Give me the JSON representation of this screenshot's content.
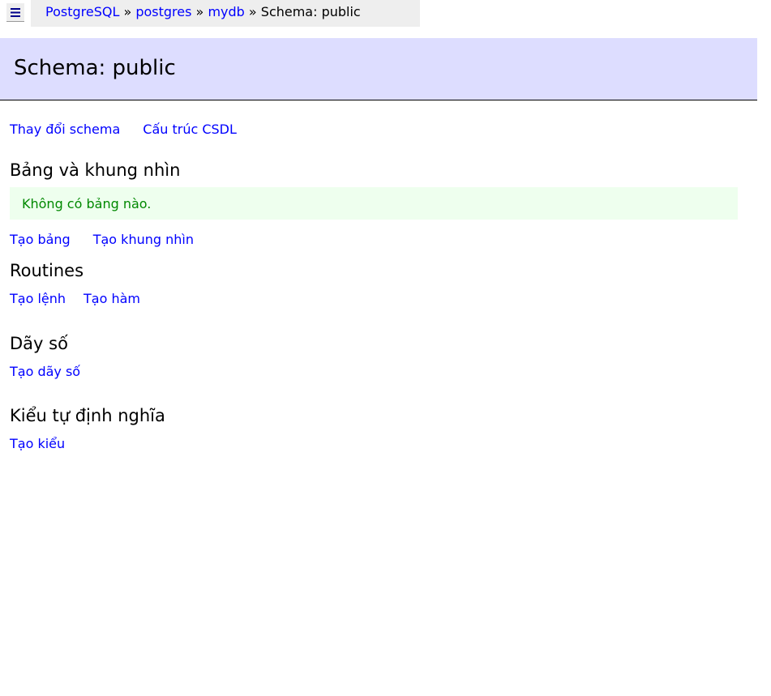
{
  "breadcrumb": {
    "items": [
      "PostgreSQL",
      "postgres",
      "mydb"
    ],
    "separator": " » ",
    "current": "Schema: public"
  },
  "header": {
    "title": "Schema: public"
  },
  "top_links": [
    "Thay đổi schema",
    "Cấu trúc CSDL"
  ],
  "tables": {
    "heading": "Bảng và khung nhìn",
    "message": "Không có bảng nào.",
    "links": [
      "Tạo bảng",
      "Tạo khung nhìn"
    ]
  },
  "routines": {
    "heading": "Routines",
    "links": [
      "Tạo lệnh",
      "Tạo hàm"
    ]
  },
  "sequences": {
    "heading": "Dãy số",
    "links": [
      "Tạo dãy số"
    ]
  },
  "types": {
    "heading": "Kiểu tự định nghĩa",
    "links": [
      "Tạo kiểu"
    ]
  }
}
